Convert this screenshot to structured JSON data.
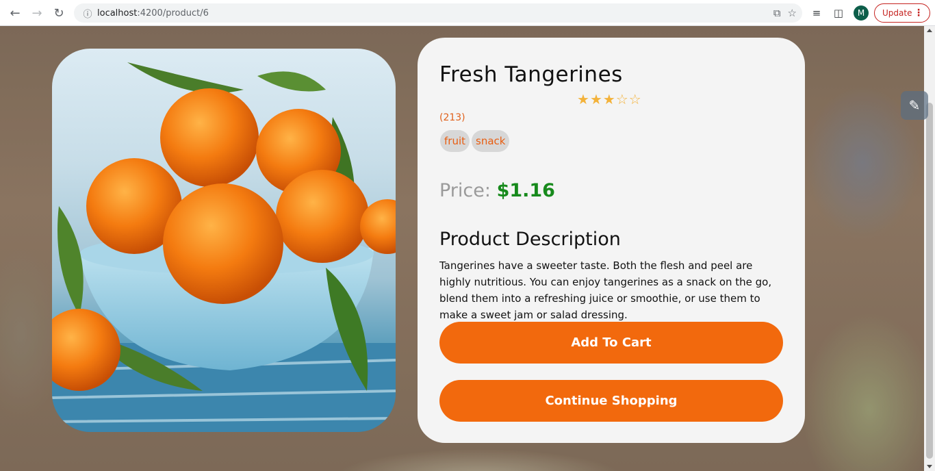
{
  "browser": {
    "url_host": "localhost",
    "url_path": ":4200/product/6",
    "avatar_letter": "M",
    "update_label": "Update"
  },
  "product": {
    "title": "Fresh Tangerines",
    "rating": 3,
    "rating_max": 5,
    "reviews": "(213)",
    "tags": [
      "fruit",
      "snack"
    ],
    "price_label": "Price:",
    "price_value": "$1.16",
    "description_title": "Product Description",
    "description": "Tangerines have a sweeter taste. Both the flesh and peel are highly nutritious. You can enjoy tangerines as a snack on the go, blend them into a refreshing juice or smoothie, or use them to make a sweet jam or salad dressing.",
    "add_to_cart_label": "Add To Cart",
    "continue_label": "Continue Shopping"
  },
  "colors": {
    "accent": "#f2690d",
    "price": "#178a1c",
    "star": "#f3b23a",
    "tag_text": "#e85d10"
  }
}
